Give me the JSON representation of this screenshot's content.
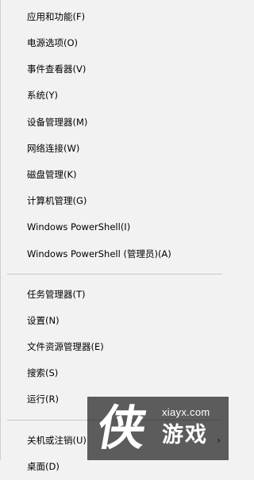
{
  "menu": {
    "group1": [
      {
        "label": "应用和功能(F)"
      },
      {
        "label": "电源选项(O)"
      },
      {
        "label": "事件查看器(V)"
      },
      {
        "label": "系统(Y)"
      },
      {
        "label": "设备管理器(M)"
      },
      {
        "label": "网络连接(W)"
      },
      {
        "label": "磁盘管理(K)"
      },
      {
        "label": "计算机管理(G)"
      },
      {
        "label": "Windows PowerShell(I)"
      },
      {
        "label": "Windows PowerShell (管理员)(A)"
      }
    ],
    "group2": [
      {
        "label": "任务管理器(T)"
      },
      {
        "label": "设置(N)"
      },
      {
        "label": "文件资源管理器(E)"
      },
      {
        "label": "搜索(S)"
      },
      {
        "label": "运行(R)"
      }
    ],
    "group3": [
      {
        "label": "关机或注销(U)"
      },
      {
        "label": "桌面(D)"
      }
    ],
    "submenu_arrow": "›"
  },
  "watermark": {
    "logo": "侠",
    "url": "xiayx.com",
    "game": "游戏"
  }
}
